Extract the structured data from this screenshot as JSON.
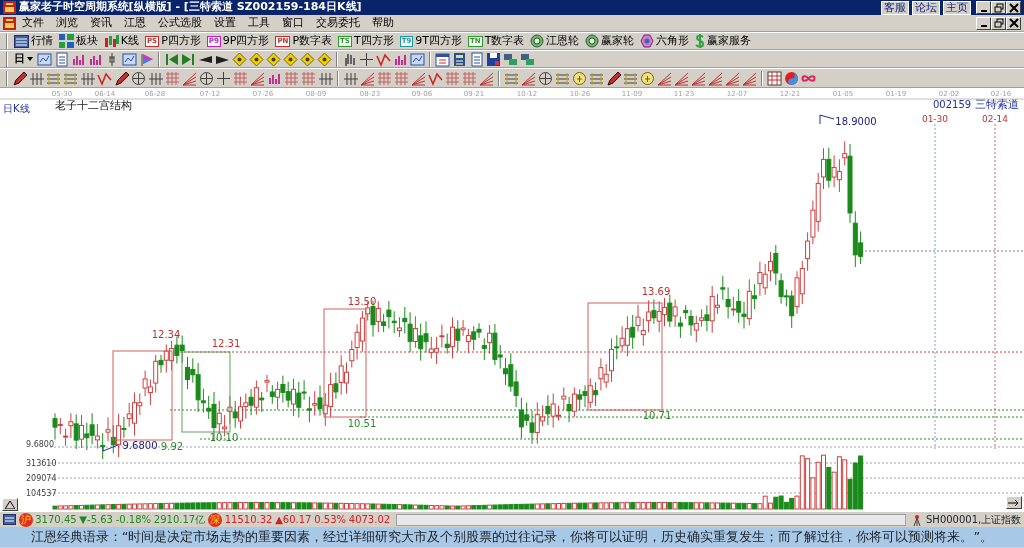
{
  "window": {
    "title": "赢家老子时空周期系统[纵横版] - [三特索道   SZ002159-184日K线]",
    "links": [
      "客服",
      "论坛",
      "主页"
    ]
  },
  "menu": {
    "items": [
      "文件",
      "浏览",
      "资讯",
      "江恩",
      "公式选股",
      "设置",
      "工具",
      "窗口",
      "交易委托",
      "帮助"
    ]
  },
  "toolbar": [
    {
      "label": "行情",
      "kind": "monitor"
    },
    {
      "label": "板块",
      "kind": "blocks"
    },
    {
      "label": "K线",
      "kind": "candles"
    },
    {
      "label": "P四方形",
      "kind": "badge",
      "badge": "PS",
      "color": "#c03030"
    },
    {
      "label": "9P四方形",
      "kind": "badge",
      "badge": "P9",
      "color": "#c020c0"
    },
    {
      "label": "P数字表",
      "kind": "badge",
      "badge": "PN",
      "color": "#c03030"
    },
    {
      "label": "T四方形",
      "kind": "badge",
      "badge": "TS",
      "color": "#2a9a2a"
    },
    {
      "label": "9T四方形",
      "kind": "badge",
      "badge": "T9",
      "color": "#1a9aa0"
    },
    {
      "label": "T数字表",
      "kind": "badge",
      "badge": "TN",
      "color": "#2a9a2a"
    },
    {
      "label": "江恩轮",
      "kind": "ring"
    },
    {
      "label": "赢家轮",
      "kind": "ring"
    },
    {
      "label": "六角形",
      "kind": "hexagon"
    },
    {
      "label": "赢家服务",
      "kind": "dollar"
    }
  ],
  "period_selector": {
    "value": "日"
  },
  "chart": {
    "period_label": "日K线",
    "title": "老子十二宫结构",
    "code": "002159",
    "name": "三特索道",
    "dates": [
      "05-30",
      "06-14",
      "06-28",
      "07-12",
      "07-26",
      "08-09",
      "08-23",
      "09-06",
      "09-21",
      "10-12",
      "10-26",
      "11-09",
      "11-23",
      "12-07",
      "12-21",
      "01-05",
      "01-19",
      "02-02",
      "02-16"
    ],
    "future_dates": [
      "01-30",
      "02-14"
    ],
    "price_labels": [
      {
        "text": "12.34",
        "color": "#c03030"
      },
      {
        "text": "12.31",
        "color": "#c03030"
      },
      {
        "text": "13.50",
        "color": "#c03030"
      },
      {
        "text": "13.69",
        "color": "#c03030"
      },
      {
        "text": "18.9000",
        "color": "#202080"
      },
      {
        "text": "10.51",
        "color": "#2a8a2a"
      },
      {
        "text": "10.71",
        "color": "#2a8a2a"
      },
      {
        "text": "10.10",
        "color": "#2a8a2a"
      },
      {
        "text": "9.92",
        "color": "#2a8a2a"
      },
      {
        "text": "9.6800",
        "color": "#202080"
      }
    ],
    "axis_price": "9.6800",
    "volume_ticks": [
      "313610",
      "209074",
      "104537"
    ]
  },
  "status_bar": {
    "indices": [
      {
        "badge": "沪",
        "value": "3170.45",
        "change": "▼-5.63",
        "percent": "-0.18%",
        "amount": "2910.17亿",
        "color": "#1a8a1a"
      },
      {
        "badge": "深",
        "value": "11510.32",
        "change": "▲60.17",
        "percent": "0.53%",
        "amount": "4073.02",
        "color": "#d02020"
      }
    ],
    "index_name": "SH000001,上证指数"
  },
  "quote": "江恩经典语录：“时间是决定市场走势的重要因素，经过详细研究大市及个别股票的过往记录，你将可以证明，历史确实重复发生；而了解过往，你将可以预测将来。”。"
}
